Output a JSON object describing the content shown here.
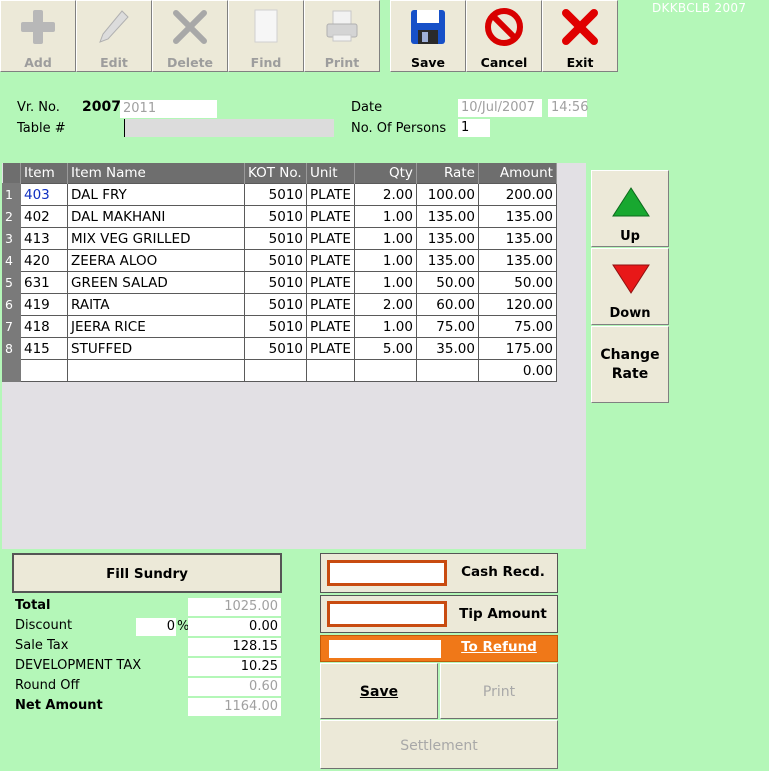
{
  "company_tag": "DKKBCLB 2007",
  "toolbar": {
    "add": "Add",
    "edit": "Edit",
    "delete": "Delete",
    "find": "Find",
    "print": "Print",
    "save": "Save",
    "cancel": "Cancel",
    "exit": "Exit"
  },
  "header": {
    "vr_no_label": "Vr. No.",
    "vr_no_value": "2007",
    "vr_no_year": "2011",
    "table_label": "Table #",
    "table_value": "",
    "date_label": "Date",
    "date_value": "10/Jul/2007",
    "time_value": "14:56",
    "persons_label": "No. Of Persons",
    "persons_value": "1"
  },
  "grid": {
    "columns": [
      "Item",
      "Item Name",
      "KOT No.",
      "Unit",
      "Qty",
      "Rate",
      "Amount"
    ],
    "rows": [
      {
        "n": "1",
        "item": "403",
        "name": "DAL FRY",
        "kot": "5010",
        "unit": "PLATE",
        "qty": "2.00",
        "rate": "100.00",
        "amount": "200.00"
      },
      {
        "n": "2",
        "item": "402",
        "name": "DAL MAKHANI",
        "kot": "5010",
        "unit": "PLATE",
        "qty": "1.00",
        "rate": "135.00",
        "amount": "135.00"
      },
      {
        "n": "3",
        "item": "413",
        "name": "MIX VEG GRILLED",
        "kot": "5010",
        "unit": "PLATE",
        "qty": "1.00",
        "rate": "135.00",
        "amount": "135.00"
      },
      {
        "n": "4",
        "item": "420",
        "name": "ZEERA ALOO",
        "kot": "5010",
        "unit": "PLATE",
        "qty": "1.00",
        "rate": "135.00",
        "amount": "135.00"
      },
      {
        "n": "5",
        "item": "631",
        "name": "GREEN SALAD",
        "kot": "5010",
        "unit": "PLATE",
        "qty": "1.00",
        "rate": "50.00",
        "amount": "50.00"
      },
      {
        "n": "6",
        "item": "419",
        "name": "RAITA",
        "kot": "5010",
        "unit": "PLATE",
        "qty": "2.00",
        "rate": "60.00",
        "amount": "120.00"
      },
      {
        "n": "7",
        "item": "418",
        "name": "JEERA RICE",
        "kot": "5010",
        "unit": "PLATE",
        "qty": "1.00",
        "rate": "75.00",
        "amount": "75.00"
      },
      {
        "n": "8",
        "item": "415",
        "name": "STUFFED",
        "kot": "5010",
        "unit": "PLATE",
        "qty": "5.00",
        "rate": "35.00",
        "amount": "175.00"
      },
      {
        "n": "",
        "item": "",
        "name": "",
        "kot": "",
        "unit": "",
        "qty": "",
        "rate": "",
        "amount": "0.00"
      }
    ]
  },
  "side": {
    "up": "Up",
    "down": "Down",
    "change_rate_1": "Change",
    "change_rate_2": "Rate"
  },
  "totals": {
    "fill_sundry": "Fill Sundry",
    "total_label": "Total",
    "total_value": "1025.00",
    "discount_label": "Discount",
    "discount_pct": "0",
    "discount_pct_sign": "%",
    "discount_value": "0.00",
    "sale_tax_label": "Sale Tax",
    "sale_tax_value": "128.15",
    "dev_tax_label": "DEVELOPMENT TAX",
    "dev_tax_value": "10.25",
    "round_off_label": "Round Off",
    "round_off_value": "0.60",
    "net_label": "Net Amount",
    "net_value": "1164.00"
  },
  "payment": {
    "cash_recd": "Cash Recd.",
    "cash_value": "",
    "tip_amount": "Tip Amount",
    "tip_value": "",
    "to_refund": "To Refund",
    "refund_value": "",
    "save": "Save",
    "print": "Print",
    "settlement": "Settlement"
  }
}
